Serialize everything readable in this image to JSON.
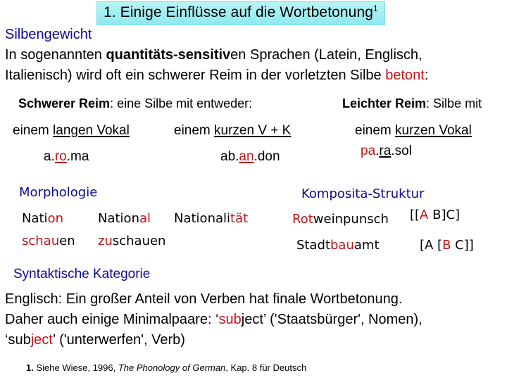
{
  "title": {
    "text": "1. Einige Einflüsse auf die Wortbetonung",
    "footnote_mark": "1"
  },
  "silbengewicht": {
    "heading": "Silbengewicht",
    "line1": {
      "pre": "In sogenannten ",
      "bold": "quantitäts-sensitiv",
      "post": "en Sprachen (Latein, Englisch,"
    },
    "line2": {
      "pre": "Italienisch) wird oft ein schwerer Reim in der vorletzten Silbe ",
      "red": "betont",
      "post": ":"
    }
  },
  "schwerer_reim": {
    "label_bold": "Schwerer Reim",
    "label_rest": ": eine Silbe mit entweder:",
    "col1": {
      "pre": "einem ",
      "ul": "langen Vokal",
      "ex": {
        "a": "a.",
        "red": "ro",
        "b": ".ma"
      }
    },
    "col2": {
      "pre": "einem ",
      "ul": "kurzen V + K",
      "ex": {
        "a": "ab.",
        "red": "an",
        "b": ".don"
      }
    }
  },
  "leichter_reim": {
    "label_bold": "Leichter Reim",
    "label_rest": ": Silbe mit",
    "col": {
      "pre": "einem ",
      "ul": "kurzen Vokal",
      "ex": {
        "red": "pa",
        "dot": ".",
        "ul": "ra",
        "b": ".sol"
      }
    }
  },
  "morphologie": {
    "heading": "Morphologie",
    "row1": [
      {
        "plain": "Nati",
        "red": "on",
        "after": ""
      },
      {
        "plain": "Nation",
        "red": "al",
        "after": ""
      },
      {
        "plain": "Nationali",
        "red": "tät",
        "after": ""
      }
    ],
    "row2": [
      {
        "red": "schau",
        "after": "en"
      },
      {
        "red": "zu",
        "after": "schauen"
      }
    ]
  },
  "komposita": {
    "heading": "Komposita-Struktur",
    "rows": [
      {
        "red": "Rot",
        "after": "weinpunsch",
        "pre": "",
        "br_pre": "[[",
        "br_red": "A",
        "br_post": " B]C]"
      },
      {
        "pre": "Stadt",
        "red": "bau",
        "after": "amt",
        "br_pre": "[A [",
        "br_red": "B",
        "br_post": " C]]"
      }
    ]
  },
  "syntaktisch": {
    "heading": "Syntaktische Kategorie",
    "line1": "Englisch: Ein großer Anteil von Verben hat finale Wortbetonung.",
    "line2": {
      "pre": "Daher auch einige Minimalpaare: ‘",
      "red": "sub",
      "post": "ject’ ('Staatsbürger', Nomen),"
    },
    "line3": {
      "pre": "‘sub",
      "red": "ject",
      "post": "’ ('unterwerfen', Verb)"
    }
  },
  "footnote": {
    "num": "1.",
    "pre": " Siehe Wiese, 1996, ",
    "italic": "The Phonology of German",
    "post": ", Kap. 8 für Deutsch"
  }
}
